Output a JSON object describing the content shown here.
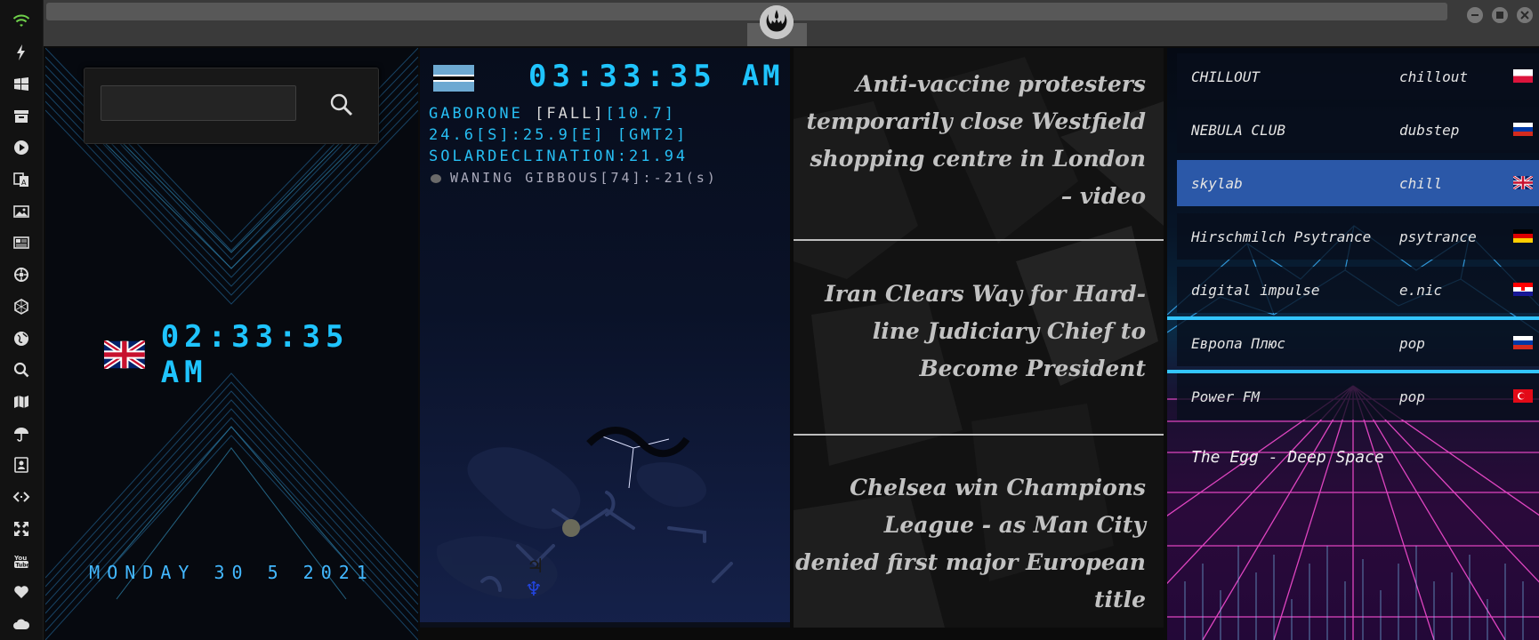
{
  "sidebar": {
    "icons": [
      "wifi-icon",
      "lightning-icon",
      "windows-icon",
      "archive-icon",
      "play-icon",
      "translate-icon",
      "image-icon",
      "news-icon",
      "gear-wheel-icon",
      "hexagon-icon",
      "globe-icon",
      "search-icon",
      "map-icon",
      "umbrella-icon",
      "contact-card-icon",
      "code-icon",
      "expand-icon",
      "youtube-icon",
      "heart-icon",
      "cloud-icon"
    ]
  },
  "window": {
    "buttons": [
      "minimize-icon",
      "maximize-icon",
      "close-icon"
    ]
  },
  "search": {
    "value": "",
    "placeholder": ""
  },
  "local_clock": {
    "time": "02:33:35 AM",
    "date": "MONDAY 30 5 2021",
    "flag": "uk"
  },
  "world_clock": {
    "time": "03:33:35",
    "ampm": "AM",
    "city_prefix": "GABORONE ",
    "season": "[FALL]",
    "day_length": "[10.7]",
    "coords": "24.6[S]:25.9[E] [GMT2]",
    "declination": "SOLARDECLINATION:21.94",
    "moon": "WANING GIBBOUS[74]:-21",
    "moon_suffix": "(s)",
    "flag": "botswana"
  },
  "news": [
    "Anti-vaccine protesters temporarily close Westfield shopping centre in London – video",
    "Iran Clears Way for Hard-line Judiciary Chief to Become President",
    "Chelsea win Champions League - as Man City denied first major European title"
  ],
  "radio": {
    "stations": [
      {
        "name": "CHILLOUT",
        "genre": "chillout",
        "flag": "poland"
      },
      {
        "name": "NEBULA CLUB",
        "genre": "dubstep",
        "flag": "russia"
      },
      {
        "name": "skylab",
        "genre": "chill",
        "flag": "uk"
      },
      {
        "name": "Hirschmilch Psytrance",
        "genre": "psytrance",
        "flag": "germany"
      },
      {
        "name": "digital impulse",
        "genre": "e.nic",
        "flag": "croatia"
      },
      {
        "name": "Европа Плюс",
        "genre": "pop",
        "flag": "russia"
      },
      {
        "name": "Power FM",
        "genre": "pop",
        "flag": "turkey"
      }
    ],
    "now_playing": "The Egg - Deep Space",
    "active_station": "skylab"
  },
  "colors": {
    "accent": "#1fc4ff",
    "active_station": "#2b58a8"
  }
}
